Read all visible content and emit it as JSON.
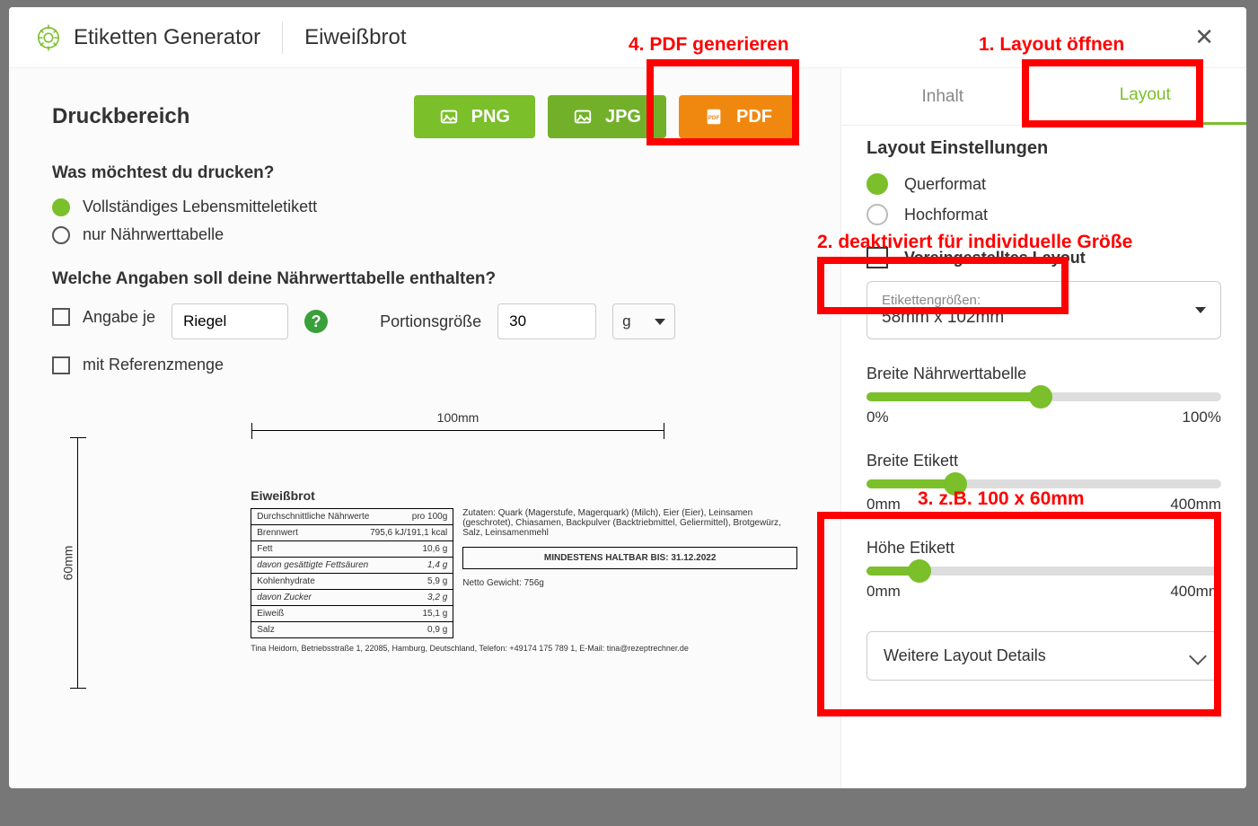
{
  "header": {
    "app": "Etiketten Generator",
    "recipe": "Eiweißbrot"
  },
  "annotations": {
    "a1": "1. Layout öffnen",
    "a2": "2. deaktiviert für individuelle Größe",
    "a3": "3. z.B. 100 x 60mm",
    "a4": "4. PDF generieren"
  },
  "left": {
    "section_title": "Druckbereich",
    "btn_png": "PNG",
    "btn_jpg": "JPG",
    "btn_pdf": "PDF",
    "q1": "Was möchtest du drucken?",
    "r1": "Vollständiges Lebensmitteletikett",
    "r2": "nur Nährwerttabelle",
    "q2": "Welche Angaben soll deine Nährwerttabelle enthalten?",
    "chk_angabe": "Angabe je",
    "angabe_val": "Riegel",
    "portion_lbl": "Portionsgröße",
    "portion_val": "30",
    "unit": "g",
    "chk_ref": "mit Referenzmenge"
  },
  "preview": {
    "width_lbl": "100mm",
    "height_lbl": "60mm",
    "title": "Eiweißbrot",
    "per": "pro 100g",
    "rows": [
      {
        "k": "Durchschnittliche Nährwerte",
        "v": ""
      },
      {
        "k": "Brennwert",
        "v": "795,6 kJ/191,1 kcal"
      },
      {
        "k": "Fett",
        "v": "10,6 g"
      },
      {
        "k": "davon gesättigte Fettsäuren",
        "v": "1,4 g",
        "sub": true
      },
      {
        "k": "Kohlenhydrate",
        "v": "5,9 g"
      },
      {
        "k": "davon Zucker",
        "v": "3,2 g",
        "sub": true
      },
      {
        "k": "Eiweiß",
        "v": "15,1 g"
      },
      {
        "k": "Salz",
        "v": "0,9 g"
      }
    ],
    "ingredients": "Zutaten: Quark (Magerstufe, Magerquark) (Milch), Eier (Eier), Leinsamen (geschrotet), Chiasamen, Backpulver (Backtriebmittel, Geliermittel), Brotgewürz, Salz, Leinsamenmehl",
    "mhd": "MINDESTENS HALTBAR BIS: 31.12.2022",
    "netweight": "Netto Gewicht: 756g",
    "footer": "Tina Heidorn, Betriebsstraße 1, 22085, Hamburg, Deutschland, Telefon: +49174 175 789 1, E-Mail: tina@rezeptrechner.de"
  },
  "right": {
    "tab_inhalt": "Inhalt",
    "tab_layout": "Layout",
    "heading": "Layout Einstellungen",
    "quer": "Querformat",
    "hoch": "Hochformat",
    "preset": "Voreingestelltes Layout",
    "size_lbl": "Etikettengrößen:",
    "size_val": "58mm x 102mm",
    "sl_tbl": "Breite Nährwerttabelle",
    "sl_tbl_min": "0%",
    "sl_tbl_max": "100%",
    "sl_w": "Breite Etikett",
    "sl_h": "Höhe Etikett",
    "sl_mm_min": "0mm",
    "sl_mm_max": "400mm",
    "details": "Weitere Layout Details"
  }
}
